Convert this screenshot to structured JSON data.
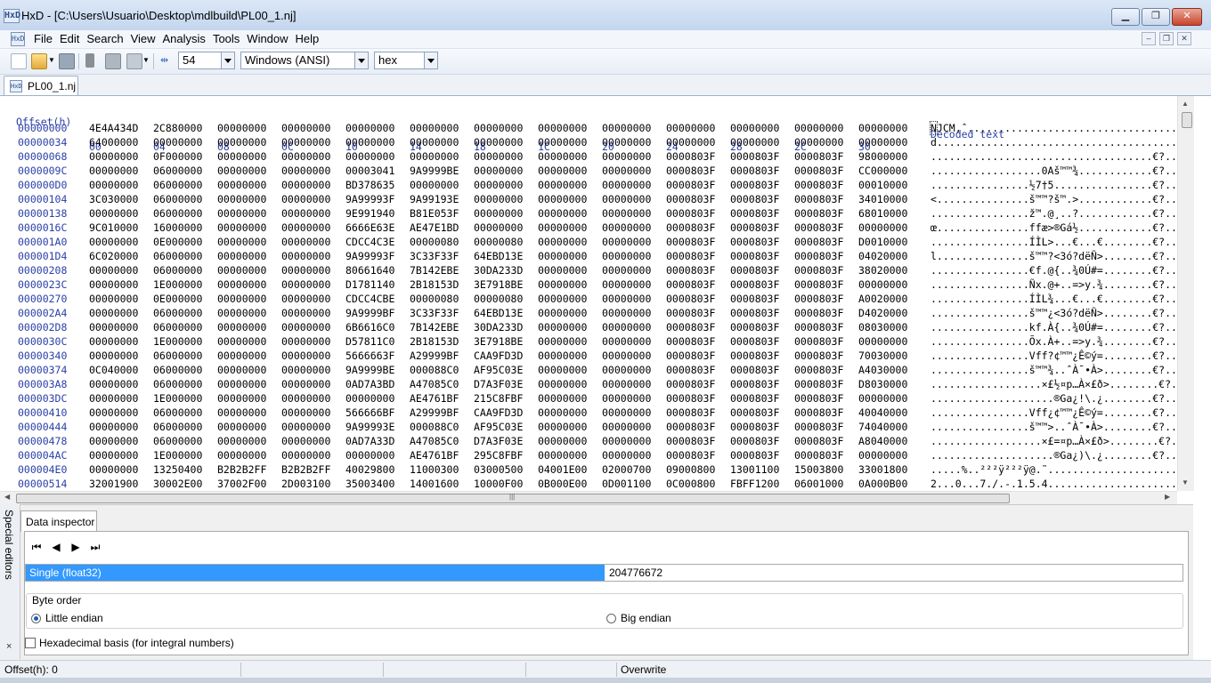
{
  "window": {
    "title": "HxD - [C:\\Users\\Usuario\\Desktop\\mdlbuild\\PL00_1.nj]",
    "app_icon": "HxD"
  },
  "menu": [
    "File",
    "Edit",
    "Search",
    "View",
    "Analysis",
    "Tools",
    "Window",
    "Help"
  ],
  "toolbar": {
    "bytes_per_row": "54",
    "charset": "Windows (ANSI)",
    "offset_base": "hex"
  },
  "tab": {
    "label": "PL00_1.nj"
  },
  "hex_header": {
    "offset_label": "Offset(h)",
    "columns": [
      "00",
      "04",
      "08",
      "0C",
      "10",
      "14",
      "18",
      "1C",
      "20",
      "24",
      "28",
      "2C",
      "30"
    ],
    "decoded_label": "Decoded text"
  },
  "rows": [
    {
      "o": "00000000",
      "h": [
        "4E4A434D",
        "2C880000",
        "00000000",
        "00000000",
        "00000000",
        "00000000",
        "00000000",
        "00000000",
        "00000000",
        "00000000",
        "00000000",
        "00000000",
        "00000000"
      ],
      "d": "NJCM,ˆ.................................................."
    },
    {
      "o": "00000034",
      "h": [
        "64000000",
        "00000000",
        "00000000",
        "00000000",
        "00000000",
        "00000000",
        "00000000",
        "00000000",
        "00000000",
        "00000000",
        "00000000",
        "00000000",
        "00000000"
      ],
      "d": "d...................................................."
    },
    {
      "o": "00000068",
      "h": [
        "00000000",
        "0F000000",
        "00000000",
        "00000000",
        "00000000",
        "00000000",
        "00000000",
        "00000000",
        "00000000",
        "0000803F",
        "0000803F",
        "0000803F",
        "98000000"
      ],
      "d": "....................................€?..€?..€?˜..."
    },
    {
      "o": "0000009C",
      "h": [
        "00000000",
        "06000000",
        "00000000",
        "00000000",
        "00003041",
        "9A9999BE",
        "00000000",
        "00000000",
        "00000000",
        "0000803F",
        "0000803F",
        "0000803F",
        "CC000000"
      ],
      "d": "..................0Aš™™¾............€?..€?..€?Ì..."
    },
    {
      "o": "000000D0",
      "h": [
        "00000000",
        "06000000",
        "00000000",
        "00000000",
        "BD378635",
        "00000000",
        "00000000",
        "00000000",
        "00000000",
        "0000803F",
        "0000803F",
        "0000803F",
        "00010000"
      ],
      "d": "................½7†5................€?..€?..€?...."
    },
    {
      "o": "00000104",
      "h": [
        "3C030000",
        "06000000",
        "00000000",
        "00000000",
        "9A99993F",
        "9A99193E",
        "00000000",
        "00000000",
        "00000000",
        "0000803F",
        "0000803F",
        "0000803F",
        "34010000"
      ],
      "d": "<...............š™™?š™.>............€?..€?..€?4..."
    },
    {
      "o": "00000138",
      "h": [
        "00000000",
        "06000000",
        "00000000",
        "00000000",
        "9E991940",
        "B81E053F",
        "00000000",
        "00000000",
        "00000000",
        "0000803F",
        "0000803F",
        "0000803F",
        "68010000"
      ],
      "d": "................ž™.@¸..?............€?..€?..€?h..."
    },
    {
      "o": "0000016C",
      "h": [
        "9C010000",
        "16000000",
        "00000000",
        "00000000",
        "6666E63E",
        "AE47E1BD",
        "00000000",
        "00000000",
        "00000000",
        "0000803F",
        "0000803F",
        "0000803F",
        "00000000"
      ],
      "d": "œ...............ffæ>®Gá½............€?..€?..€?...."
    },
    {
      "o": "000001A0",
      "h": [
        "00000000",
        "0E000000",
        "00000000",
        "00000000",
        "CDCC4C3E",
        "00000080",
        "00000080",
        "00000000",
        "00000000",
        "0000803F",
        "0000803F",
        "0000803F",
        "D0010000"
      ],
      "d": "................ÍÌL>...€...€........€?..€?..€?Ð..."
    },
    {
      "o": "000001D4",
      "h": [
        "6C020000",
        "06000000",
        "00000000",
        "00000000",
        "9A99993F",
        "3C33F33F",
        "64EBD13E",
        "00000000",
        "00000000",
        "0000803F",
        "0000803F",
        "0000803F",
        "04020000"
      ],
      "d": "l...............š™™?<3ó?dëÑ>........€?..€?..€?...."
    },
    {
      "o": "00000208",
      "h": [
        "00000000",
        "06000000",
        "00000000",
        "00000000",
        "80661640",
        "7B142EBE",
        "30DA233D",
        "00000000",
        "00000000",
        "0000803F",
        "0000803F",
        "0000803F",
        "38020000"
      ],
      "d": "................€f.@{..¾0Ú#=........€?..€?..€?8..."
    },
    {
      "o": "0000023C",
      "h": [
        "00000000",
        "1E000000",
        "00000000",
        "00000000",
        "D1781140",
        "2B18153D",
        "3E7918BE",
        "00000000",
        "00000000",
        "0000803F",
        "0000803F",
        "0000803F",
        "00000000"
      ],
      "d": "................Ñx.@+..=>y.¾........€?..€?..€?...."
    },
    {
      "o": "00000270",
      "h": [
        "00000000",
        "0E000000",
        "00000000",
        "00000000",
        "CDCC4CBE",
        "00000080",
        "00000080",
        "00000000",
        "00000000",
        "0000803F",
        "0000803F",
        "0000803F",
        "A0020000"
      ],
      "d": "................ÍÌL¾...€...€........€?..€?..€? ..."
    },
    {
      "o": "000002A4",
      "h": [
        "00000000",
        "06000000",
        "00000000",
        "00000000",
        "9A9999BF",
        "3C33F33F",
        "64EBD13E",
        "00000000",
        "00000000",
        "0000803F",
        "0000803F",
        "0000803F",
        "D4020000"
      ],
      "d": "................š™™¿<3ó?dëÑ>........€?..€?..€?Ô..."
    },
    {
      "o": "000002D8",
      "h": [
        "00000000",
        "06000000",
        "00000000",
        "00000000",
        "6B6616C0",
        "7B142EBE",
        "30DA233D",
        "00000000",
        "00000000",
        "0000803F",
        "0000803F",
        "0000803F",
        "08030000"
      ],
      "d": "................kf.À{..¾0Ú#=........€?..€?..€?...."
    },
    {
      "o": "0000030C",
      "h": [
        "00000000",
        "1E000000",
        "00000000",
        "00000000",
        "D57811C0",
        "2B18153D",
        "3E7918BE",
        "00000000",
        "00000000",
        "0000803F",
        "0000803F",
        "0000803F",
        "00000000"
      ],
      "d": "................Õx.À+..=>y.¾........€?..€?..€?...."
    },
    {
      "o": "00000340",
      "h": [
        "00000000",
        "06000000",
        "00000000",
        "00000000",
        "5666663F",
        "A29999BF",
        "CAA9FD3D",
        "00000000",
        "00000000",
        "0000803F",
        "0000803F",
        "0000803F",
        "70030000"
      ],
      "d": "................Vff?¢™™¿Ê©ý=........€?..€?..€?p..."
    },
    {
      "o": "00000374",
      "h": [
        "0C040000",
        "06000000",
        "00000000",
        "00000000",
        "9A9999BE",
        "000088C0",
        "AF95C03E",
        "00000000",
        "00000000",
        "0000803F",
        "0000803F",
        "0000803F",
        "A4030000"
      ],
      "d": "................š™™¾..ˆÀ¯•À>........€?..€?..€?¤..."
    },
    {
      "o": "000003A8",
      "h": [
        "00000000",
        "06000000",
        "00000000",
        "00000000",
        "0AD7A3BD",
        "A47085C0",
        "D7A3F03E",
        "00000000",
        "00000000",
        "0000803F",
        "0000803F",
        "0000803F",
        "D8030000"
      ],
      "d": "..................×£½¤p…À×£ð>........€?..€?..€?Ø..."
    },
    {
      "o": "000003DC",
      "h": [
        "00000000",
        "1E000000",
        "00000000",
        "00000000",
        "00000000",
        "AE4761BF",
        "215C8FBF",
        "00000000",
        "00000000",
        "0000803F",
        "0000803F",
        "0000803F",
        "00000000"
      ],
      "d": "....................®Ga¿!\\.¿........€?..€?..€?...."
    },
    {
      "o": "00000410",
      "h": [
        "00000000",
        "06000000",
        "00000000",
        "00000000",
        "566666BF",
        "A29999BF",
        "CAA9FD3D",
        "00000000",
        "00000000",
        "0000803F",
        "0000803F",
        "0000803F",
        "40040000"
      ],
      "d": "................Vff¿¢™™¿Ê©ý=........€?..€?..€?@..."
    },
    {
      "o": "00000444",
      "h": [
        "00000000",
        "06000000",
        "00000000",
        "00000000",
        "9A99993E",
        "000088C0",
        "AF95C03E",
        "00000000",
        "00000000",
        "0000803F",
        "0000803F",
        "0000803F",
        "74040000"
      ],
      "d": "................š™™>..ˆÀ¯•À>........€?..€?..€?t..."
    },
    {
      "o": "00000478",
      "h": [
        "00000000",
        "06000000",
        "00000000",
        "00000000",
        "0AD7A33D",
        "A47085C0",
        "D7A3F03E",
        "00000000",
        "00000000",
        "0000803F",
        "0000803F",
        "0000803F",
        "A8040000"
      ],
      "d": "..................×£=¤p…À×£ð>........€?..€?..€?¨..."
    },
    {
      "o": "000004AC",
      "h": [
        "00000000",
        "1E000000",
        "00000000",
        "00000000",
        "00000000",
        "AE4761BF",
        "295C8FBF",
        "00000000",
        "00000000",
        "0000803F",
        "0000803F",
        "0000803F",
        "00000000"
      ],
      "d": "....................®Ga¿)\\.¿........€?..€?..€?...."
    },
    {
      "o": "000004E0",
      "h": [
        "00000000",
        "13250400",
        "B2B2B2FF",
        "B2B2B2FF",
        "40029800",
        "11000300",
        "03000500",
        "04001E00",
        "02000700",
        "09000800",
        "13001100",
        "15003800",
        "33001800"
      ],
      "d": ".....%..²²²ÿ²²²ÿ@.˜................................8.3..."
    },
    {
      "o": "00000514",
      "h": [
        "32001900",
        "30002E00",
        "37002F00",
        "2D003100",
        "35003400",
        "14001600",
        "10000F00",
        "0B000E00",
        "0D001100",
        "0C000800",
        "FBFF1200",
        "06001000",
        "0A000B00"
      ],
      "d": "2...0...7./.-.1.5.4............................ûÿ......."
    }
  ],
  "inspector": {
    "side_label": "Special editors",
    "tab_label": "Data inspector",
    "nav": [
      "⏮",
      "◀",
      "▶",
      "⏭"
    ],
    "type_name": "Single (float32)",
    "type_value": "204776672",
    "byte_order_title": "Byte order",
    "little_endian": "Little endian",
    "big_endian": "Big endian",
    "hex_basis": "Hexadecimal basis (for integral numbers)",
    "close_glyph": "×"
  },
  "status": {
    "offset": "Offset(h): 0",
    "mode": "Overwrite"
  }
}
